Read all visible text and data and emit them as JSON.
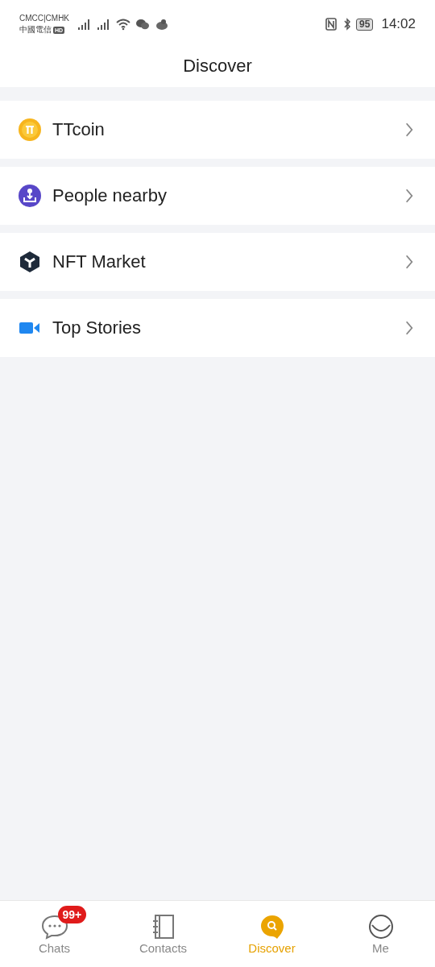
{
  "status_bar": {
    "carrier_1": "CMCC|CMHK",
    "carrier_2": "中國電信",
    "hd_badge": "HD",
    "battery": "95",
    "time": "14:02"
  },
  "header": {
    "title": "Discover"
  },
  "items": [
    {
      "kind": "coin",
      "label": "TTcoin"
    },
    {
      "kind": "nearby",
      "label": "People nearby"
    },
    {
      "kind": "nft",
      "label": "NFT Market"
    },
    {
      "kind": "video",
      "label": "Top Stories"
    }
  ],
  "tabs": [
    {
      "kind": "chats",
      "label": "Chats",
      "selected": false,
      "badge": "99+"
    },
    {
      "kind": "contacts",
      "label": "Contacts",
      "selected": false
    },
    {
      "kind": "discover",
      "label": "Discover",
      "selected": true
    },
    {
      "kind": "me",
      "label": "Me",
      "selected": false
    }
  ]
}
